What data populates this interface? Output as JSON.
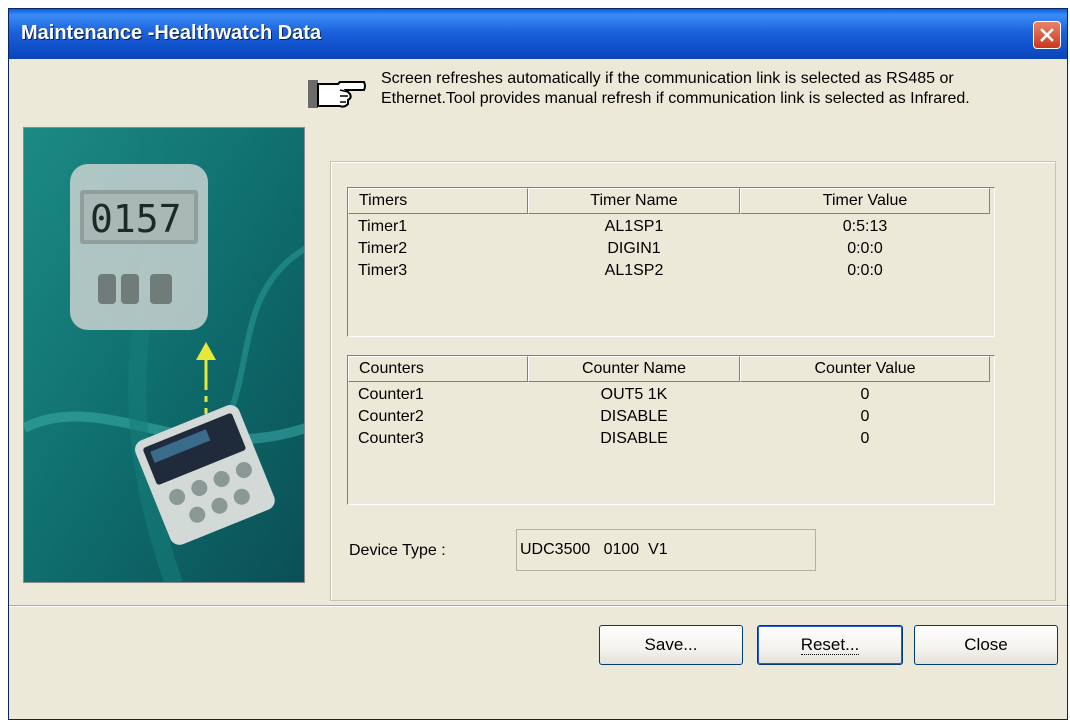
{
  "window": {
    "title": "Maintenance -Healthwatch Data"
  },
  "info": {
    "icon": "pointing-hand-icon",
    "text": "Screen refreshes automatically if the communication link is selected as RS485 or Ethernet.Tool provides manual refresh if communication link is selected as Infrared."
  },
  "illustration": {
    "display_reading": "0157"
  },
  "timers": {
    "headers": [
      "Timers",
      "Timer Name",
      "Timer Value"
    ],
    "rows": [
      [
        "Timer1",
        "AL1SP1",
        "0:5:13"
      ],
      [
        "Timer2",
        "DIGIN1",
        "0:0:0"
      ],
      [
        "Timer3",
        "AL1SP2",
        "0:0:0"
      ]
    ]
  },
  "counters": {
    "headers": [
      "Counters",
      "Counter Name",
      "Counter Value"
    ],
    "rows": [
      [
        "Counter1",
        "OUT5 1K",
        "0"
      ],
      [
        "Counter2",
        "DISABLE",
        "0"
      ],
      [
        "Counter3",
        "DISABLE",
        "0"
      ]
    ]
  },
  "device": {
    "label": "Device Type :",
    "value": "UDC3500   0100  V1"
  },
  "buttons": {
    "save": "Save...",
    "reset": "Reset...",
    "close": "Close"
  },
  "colors": {
    "title_bar": "#1c62dc",
    "dialog_bg": "#ece9d8",
    "illustration_bg": "#0f6e6e",
    "close_button": "#c9381f"
  }
}
